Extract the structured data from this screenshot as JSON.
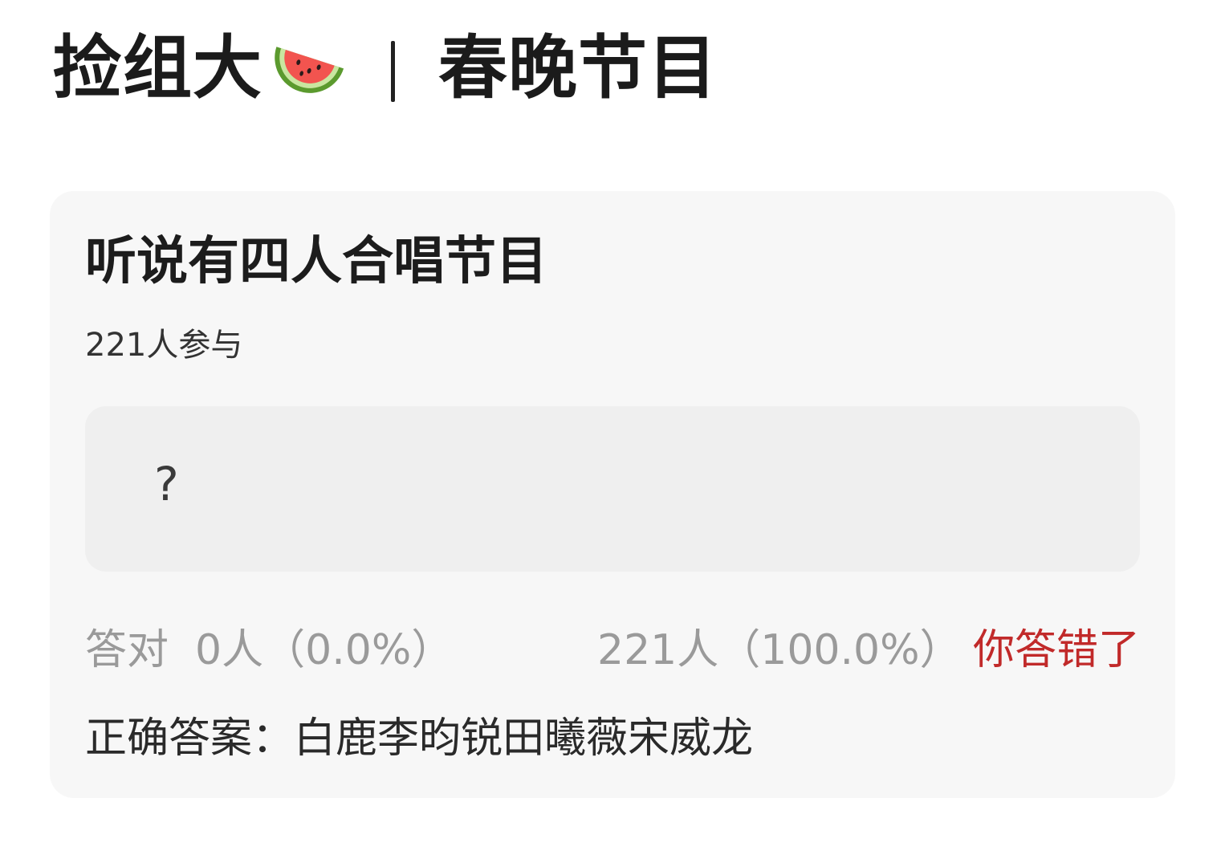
{
  "header": {
    "title": "捡组大",
    "emoji_icon": "watermelon-icon",
    "divider": "｜",
    "section": "春晚节目"
  },
  "quiz": {
    "question": "听说有四人合唱节目",
    "participants": "221人参与",
    "option_text": "?",
    "correct_stat": "答对  0人（0.0%）",
    "wrong_stat": "221人（100.0%）",
    "result_badge": "你答错了",
    "answer": "正确答案：白鹿李昀锐田曦薇宋威龙"
  },
  "colors": {
    "card_bg": "#f7f7f7",
    "option_bg": "#efefef",
    "muted_text": "#9a9a9a",
    "error_red": "#c12a2a"
  }
}
